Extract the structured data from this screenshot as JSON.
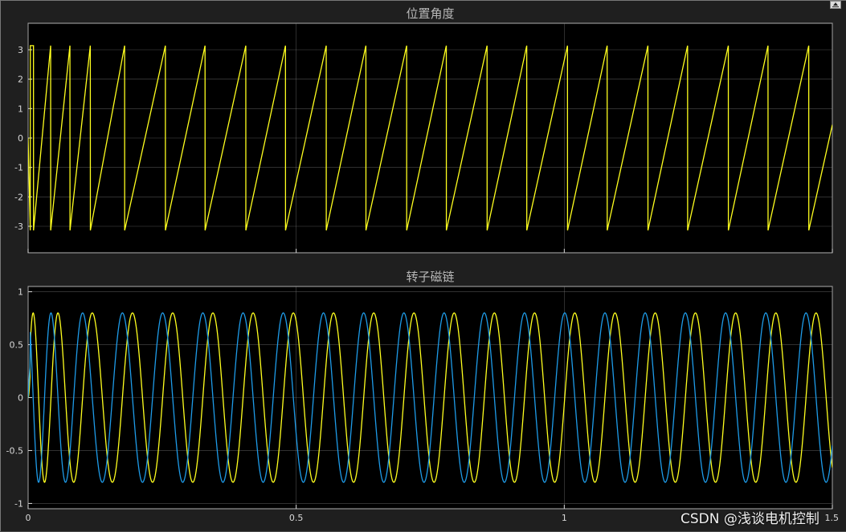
{
  "watermark": "CSDN @浅谈电机控制",
  "colors": {
    "series1": "#ffff1e",
    "series2": "#1e9be8",
    "axes_bg": "#000000",
    "grid": "#8a8a8a",
    "figure_bg": "#1f1f1f"
  },
  "icons": {
    "undock": "undock-icon"
  },
  "chart_data": [
    {
      "type": "line",
      "title": "位置角度",
      "xlim": [
        0,
        1.5
      ],
      "ylim": [
        -3.9,
        3.9
      ],
      "xticks": [
        "0",
        "0.5",
        "1",
        "1.5"
      ],
      "xtick_values": [
        0,
        0.5,
        1,
        1.5
      ],
      "yticks": [
        "3",
        "2",
        "1",
        "0",
        "-1",
        "-2",
        "-3"
      ],
      "ytick_values": [
        3,
        2,
        1,
        0,
        -1,
        -2,
        -3
      ],
      "grid": true,
      "series": [
        {
          "color": "#ffff1e",
          "x": [
            0,
            0.004,
            0.0041,
            0.01,
            0.0101,
            0.042,
            0.0421,
            0.078,
            0.0781,
            0.116,
            0.1161,
            0.18,
            0.1801,
            0.256,
            0.2561,
            0.33,
            0.3301,
            0.406,
            0.4061,
            0.48,
            0.4801,
            0.556,
            0.5561,
            0.63,
            0.6301,
            0.706,
            0.7061,
            0.78,
            0.7801,
            0.856,
            0.8561,
            0.93,
            0.9301,
            1.006,
            1.0061,
            1.08,
            1.0801,
            1.156,
            1.1561,
            1.23,
            1.2301,
            1.306,
            1.3061,
            1.38,
            1.3801,
            1.456,
            1.4561,
            1.5
          ],
          "y": [
            0,
            -3.14,
            3.14,
            3.14,
            -3.14,
            3.14,
            -3.14,
            3.14,
            -3.14,
            3.14,
            -3.14,
            3.14,
            -3.14,
            3.14,
            -3.14,
            3.14,
            -3.14,
            3.14,
            -3.14,
            3.14,
            -3.14,
            3.14,
            -3.14,
            3.14,
            -3.14,
            3.14,
            -3.14,
            3.14,
            -3.14,
            3.14,
            -3.14,
            3.14,
            -3.14,
            3.14,
            -3.14,
            3.14,
            -3.14,
            3.14,
            -3.14,
            3.14,
            -3.14,
            3.14,
            -3.14,
            3.14,
            -3.14,
            3.14,
            -3.14,
            0.45
          ]
        }
      ]
    },
    {
      "type": "line",
      "title": "转子磁链",
      "xlim": [
        0,
        1.5
      ],
      "ylim": [
        -1.05,
        1.05
      ],
      "xticks": [
        "0",
        "0.5",
        "1",
        "1.5"
      ],
      "xtick_values": [
        0,
        0.5,
        1,
        1.5
      ],
      "yticks": [
        "1",
        "0.5",
        "0",
        "-0.5",
        "-1"
      ],
      "ytick_values": [
        1,
        0.5,
        0,
        -0.5,
        -1
      ],
      "grid": true,
      "amplitude": 0.8,
      "period_steady": 0.075,
      "period_start": 0.036,
      "series": [
        {
          "color": "#ffff1e",
          "phase": 0
        },
        {
          "color": "#1e9be8",
          "phase": 1.5708
        }
      ]
    }
  ]
}
